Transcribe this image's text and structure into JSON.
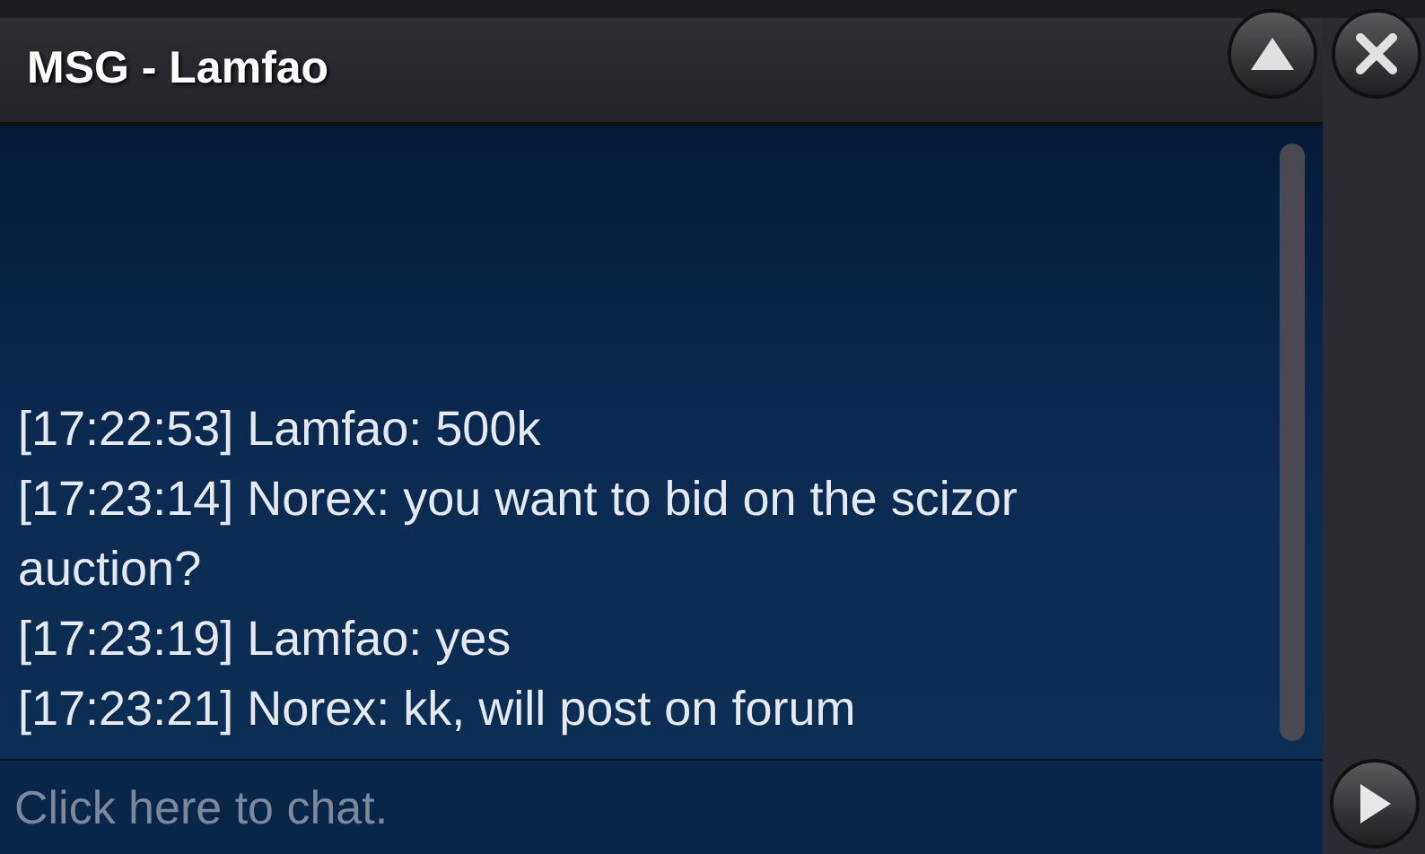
{
  "window": {
    "title": "MSG - Lamfao"
  },
  "messages": [
    {
      "text": "[17:22:53] Lamfao: 500k"
    },
    {
      "text": "[17:23:14] Norex: you want to bid on the scizor auction?"
    },
    {
      "text": "[17:23:19] Lamfao: yes"
    },
    {
      "text": "[17:23:21] Norex: kk, will post on forum"
    }
  ],
  "chat_input": {
    "placeholder": "Click here to chat."
  }
}
